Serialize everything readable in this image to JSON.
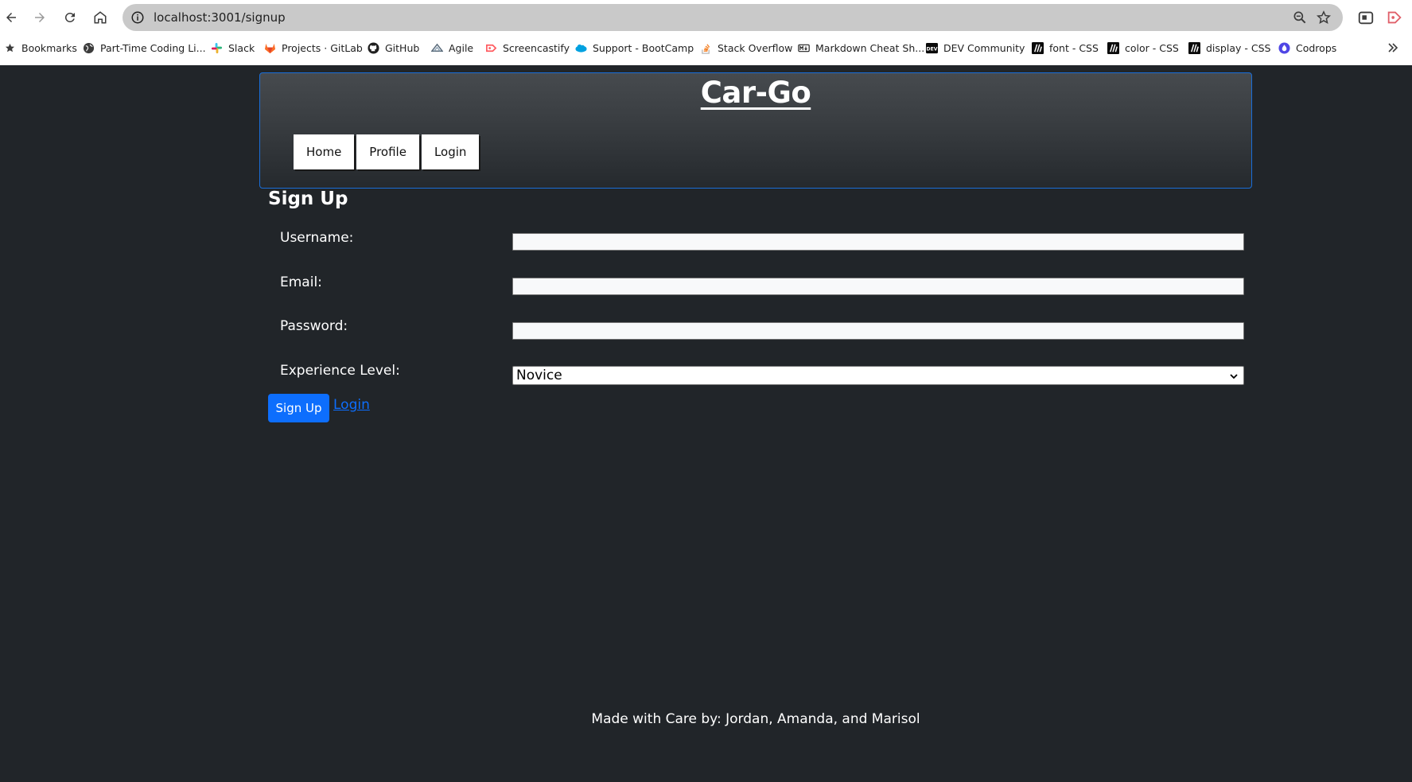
{
  "browser": {
    "url": "localhost:3001/signup",
    "bookmarks": [
      {
        "label": "Bookmarks",
        "icon": "star-icon"
      },
      {
        "label": "Part-Time Coding Li...",
        "icon": "globe-icon"
      },
      {
        "label": "Slack",
        "icon": "slack-icon"
      },
      {
        "label": "Projects · GitLab",
        "icon": "gitlab-icon"
      },
      {
        "label": "GitHub",
        "icon": "github-icon"
      },
      {
        "label": "Agile",
        "icon": "agile-icon"
      },
      {
        "label": "Screencastify",
        "icon": "screencastify-icon"
      },
      {
        "label": "Support - BootCamp",
        "icon": "salesforce-icon"
      },
      {
        "label": "Stack Overflow",
        "icon": "stackoverflow-icon"
      },
      {
        "label": "Markdown Cheat Sh...",
        "icon": "markdown-icon"
      },
      {
        "label": "DEV Community",
        "icon": "dev-icon"
      },
      {
        "label": "font - CSS",
        "icon": "mdn-icon"
      },
      {
        "label": "color - CSS",
        "icon": "mdn-icon"
      },
      {
        "label": "display - CSS",
        "icon": "mdn-icon"
      },
      {
        "label": "Codrops",
        "icon": "codrops-icon"
      }
    ]
  },
  "header": {
    "title": "Car-Go",
    "nav": [
      "Home",
      "Profile",
      "Login"
    ]
  },
  "form": {
    "title": "Sign Up",
    "username_label": "Username:",
    "email_label": "Email:",
    "password_label": "Password:",
    "experience_label": "Experience Level:",
    "experience_value": "Novice",
    "submit_label": "Sign Up",
    "login_link": "Login"
  },
  "footer": {
    "text": "Made with Care by: Jordan, Amanda, and Marisol"
  },
  "colors": {
    "page_bg": "#212529",
    "primary": "#0d6efd",
    "header_border": "#1a6ed8"
  }
}
